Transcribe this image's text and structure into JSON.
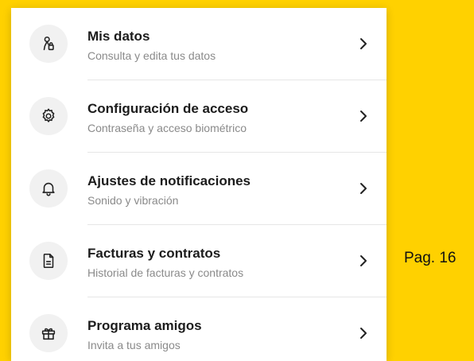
{
  "menu": {
    "items": [
      {
        "title": "Mis datos",
        "subtitle": "Consulta y edita tus datos",
        "icon": "user-lock-icon"
      },
      {
        "title": "Configuración de acceso",
        "subtitle": "Contraseña y acceso biométrico",
        "icon": "gear-icon"
      },
      {
        "title": "Ajustes de notificaciones",
        "subtitle": "Sonido y vibración",
        "icon": "bell-icon"
      },
      {
        "title": "Facturas y contratos",
        "subtitle": "Historial de facturas y contratos",
        "icon": "document-icon"
      },
      {
        "title": "Programa amigos",
        "subtitle": "Invita a tus amigos",
        "icon": "gift-icon"
      }
    ]
  },
  "page_number": "Pag. 16",
  "colors": {
    "background": "#FFD100",
    "panel": "#FFFFFF",
    "icon_circle": "#F1F1F1",
    "title": "#1C1C1C",
    "subtitle": "#8A8A8A"
  }
}
